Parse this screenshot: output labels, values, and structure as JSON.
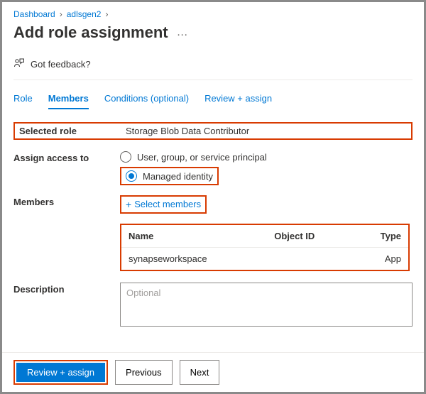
{
  "breadcrumb": {
    "item1": "Dashboard",
    "item2": "adlsgen2"
  },
  "page_title": "Add role assignment",
  "feedback_label": "Got feedback?",
  "tabs": {
    "role": "Role",
    "members": "Members",
    "conditions": "Conditions (optional)",
    "review": "Review + assign"
  },
  "fields": {
    "selected_role_label": "Selected role",
    "selected_role_value": "Storage Blob Data Contributor",
    "assign_access_label": "Assign access to",
    "radio_user": "User, group, or service principal",
    "radio_mi": "Managed identity",
    "members_label": "Members",
    "select_members": "Select members",
    "description_label": "Description",
    "description_placeholder": "Optional"
  },
  "table": {
    "col_name": "Name",
    "col_objectid": "Object ID",
    "col_type": "Type",
    "row1_name": "synapseworkspace",
    "row1_objectid": "",
    "row1_type": "App"
  },
  "buttons": {
    "review_assign": "Review + assign",
    "previous": "Previous",
    "next": "Next"
  }
}
